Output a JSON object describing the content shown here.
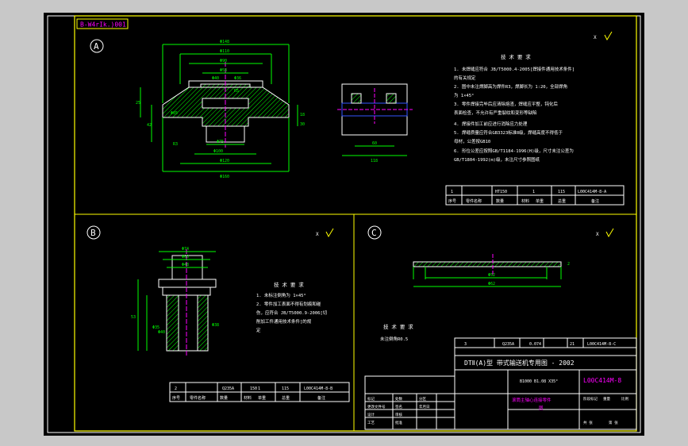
{
  "drawing": {
    "code_box": "B-W4rIk.)001",
    "view_labels": {
      "a": "A",
      "b": "B",
      "c": "C"
    },
    "roughness": {
      "a": "X",
      "b": "X",
      "c": "X"
    },
    "tech_title": "技 术 要 求",
    "tech_a": [
      "1. 未焊缝应符合 JB/T5000.4-2005[焊接件通用技术条件]",
      "   的有关规定",
      "2. 图中未注焊脚高为焊件R3，焊脚长为 1:20，全部焊角",
      "   为 1×45°",
      "3. 零件焊接完毕后应清除熔渣，焊缝应平整，钝化后",
      "   表面检查，不允许有严重裂纹和变形等缺陷",
      "4. 焊接件加工前应进行消除应力处理",
      "5. 焊缝质量应符合GB3323标准Ⅱ级，焊缝高度不得低于",
      "   母材，公差按GB10",
      "6. 形位公差应按照GB/T1184-1996(H)级，尺寸未注公差为",
      "   GB/T1804-1992(m)级，未注尺寸参照图纸"
    ],
    "parts_a": {
      "row": [
        "1",
        "件",
        "HT150",
        "1",
        "115",
        "L00C414M-8-A"
      ],
      "header": [
        "序号",
        "零件名称",
        "数量",
        "材料",
        "单重",
        "总重",
        "备注"
      ]
    },
    "dims_a": [
      "Φ148",
      "Φ110",
      "Φ90",
      "Φ58",
      "Φ40",
      "Φ36",
      "Φ58",
      "Φ60",
      "Φ80",
      "Φ75",
      "Φ100",
      "Φ120",
      "Φ160",
      "Φ85",
      "R5",
      "R3",
      "25",
      "42",
      "18",
      "30",
      "60",
      "118"
    ],
    "tech_b_title": "技 术 要 求",
    "tech_b": [
      "1. 未标注倒角为 1×45°",
      "2. 零件加工表面不得有划痕和碰",
      "   伤，应符合 JB/T5000.9-2006[切",
      "   削加工件通用技术条件]的规",
      "   定"
    ],
    "parts_b": {
      "row": [
        "2",
        "Q235A",
        "150",
        "1",
        "115",
        "L00C414M-8-B"
      ],
      "header": [
        "序号",
        "零件名称",
        "数量",
        "材料",
        "单重",
        "总重",
        "备注"
      ]
    },
    "dims_b": [
      "Φ74",
      "Φ60",
      "Φ48",
      "Φ50",
      "Φ35",
      "Φ40",
      "Φ38",
      "30",
      "53",
      "116"
    ],
    "tech_c_title": "技 术 要 求",
    "tech_c": [
      "未注倒角R0.5"
    ],
    "dims_c": [
      "Φ52",
      "Φ62",
      "2"
    ],
    "parts_c": {
      "row": [
        "3",
        "Q235A",
        "0.074",
        "21",
        "L00C414M-8-C"
      ]
    },
    "title_block": {
      "project": "DTⅡ(A)型 带式输送机专用图 - 2002",
      "scale_info": "B1000 B1.08 X35°",
      "drawing_no": "L00C414M-8",
      "part_name": "滚筒主轴心连接零件",
      "part_name2": "图",
      "sub_labels": [
        "标记",
        "处数",
        "分区",
        "更改文件号",
        "签名",
        "年月日",
        "设计",
        "审核",
        "工艺",
        "批准",
        "阶段标记",
        "重量",
        "比例",
        "共 张",
        "第 张"
      ]
    }
  },
  "colors": {
    "background": "#000000",
    "frame": "#ffff00",
    "line": "#00ff00",
    "hatch": "#00ff00",
    "center": "#ff00ff",
    "text_white": "#ffffff",
    "dim": "#00ff00"
  }
}
